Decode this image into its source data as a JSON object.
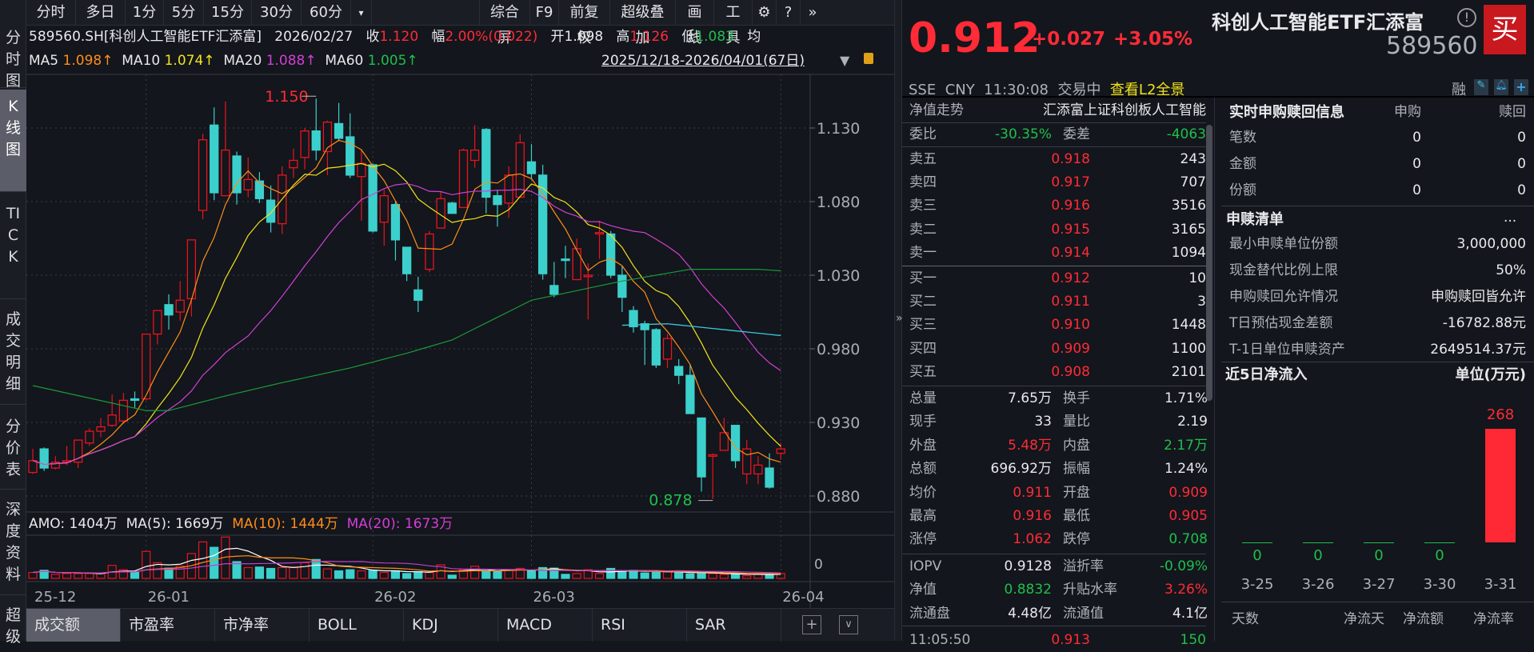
{
  "toolbar": {
    "periods": [
      "分时",
      "多日",
      "1分",
      "5分",
      "15分",
      "30分",
      "60分"
    ],
    "more": "▾",
    "right": [
      "综合屏",
      "F9",
      "前复权",
      "超级叠加",
      "画线",
      "工具"
    ]
  },
  "sidebar": [
    "分时图",
    "K线图",
    "TICK",
    "成交明细",
    "分价表",
    "深度资料",
    "超级"
  ],
  "info": {
    "code_name": "589560.SH[科创人工智能ETF汇添富]",
    "date": "2026/02/27",
    "close_label": "收",
    "close": "1.120",
    "range_label": "幅",
    "range": "2.00%(0.022)",
    "open_label": "开",
    "open": "1.098",
    "high_label": "高",
    "high": "1.126",
    "low_label": "低",
    "low": "1.083",
    "avg_label": "均"
  },
  "ma": {
    "ma5_label": "MA5",
    "ma5": "1.098↑",
    "ma10_label": "MA10",
    "ma10": "1.074↑",
    "ma20_label": "MA20",
    "ma20": "1.088↑",
    "ma60_label": "MA60",
    "ma60": "1.005↑",
    "date_range": "2025/12/18-2026/04/01(67日)"
  },
  "volume": {
    "amo": "AMO: 1404万",
    "ma5": "MA(5): 1669万",
    "ma10": "MA(10): 1444万",
    "ma20": "MA(20): 1673万",
    "zero": "0"
  },
  "tabs": [
    "成交额",
    "市盈率",
    "市净率",
    "BOLL",
    "KDJ",
    "MACD",
    "RSI",
    "SAR"
  ],
  "chart_data": {
    "type": "candlestick",
    "price_ticks": [
      "1.130",
      "1.080",
      "1.030",
      "0.980",
      "0.930",
      "0.880"
    ],
    "ylim": [
      0.88,
      1.13
    ],
    "date_labels": [
      {
        "i": 0,
        "t": "25-12"
      },
      {
        "i": 10,
        "t": "26-01"
      },
      {
        "i": 30,
        "t": "26-02"
      },
      {
        "i": 44,
        "t": "26-03"
      },
      {
        "i": 66,
        "t": "26-04"
      }
    ],
    "annotations": {
      "high": {
        "i": 25,
        "text": "1.150"
      },
      "low": {
        "i": 60,
        "text": "0.878"
      }
    },
    "ohlc": [
      [
        0.896,
        0.912,
        0.895,
        0.904
      ],
      [
        0.912,
        0.913,
        0.897,
        0.899
      ],
      [
        0.899,
        0.907,
        0.898,
        0.903
      ],
      [
        0.903,
        0.914,
        0.901,
        0.904
      ],
      [
        0.903,
        0.918,
        0.899,
        0.918
      ],
      [
        0.916,
        0.926,
        0.914,
        0.924
      ],
      [
        0.924,
        0.933,
        0.92,
        0.927
      ],
      [
        0.928,
        0.949,
        0.927,
        0.935
      ],
      [
        0.931,
        0.95,
        0.929,
        0.945
      ],
      [
        0.946,
        0.951,
        0.94,
        0.945
      ],
      [
        0.946,
        0.99,
        0.945,
        0.99
      ],
      [
        0.99,
        1.006,
        0.983,
        1.006
      ],
      [
        1.01,
        1.017,
        0.993,
        1.003
      ],
      [
        1.005,
        1.026,
        0.999,
        1.013
      ],
      [
        1.014,
        1.054,
        1.002,
        1.054
      ],
      [
        1.074,
        1.126,
        1.068,
        1.122
      ],
      [
        1.132,
        1.144,
        1.081,
        1.086
      ],
      [
        1.084,
        1.148,
        1.084,
        1.115
      ],
      [
        1.111,
        1.114,
        1.078,
        1.086
      ],
      [
        1.088,
        1.11,
        1.083,
        1.095
      ],
      [
        1.094,
        1.1,
        1.079,
        1.082
      ],
      [
        1.081,
        1.091,
        1.059,
        1.066
      ],
      [
        1.065,
        1.104,
        1.058,
        1.098
      ],
      [
        1.103,
        1.116,
        1.096,
        1.108
      ],
      [
        1.11,
        1.13,
        1.102,
        1.128
      ],
      [
        1.128,
        1.15,
        1.108,
        1.115
      ],
      [
        1.114,
        1.135,
        1.098,
        1.134
      ],
      [
        1.133,
        1.147,
        1.121,
        1.123
      ],
      [
        1.124,
        1.14,
        1.096,
        1.098
      ],
      [
        1.097,
        1.115,
        1.067,
        1.106
      ],
      [
        1.105,
        1.106,
        1.059,
        1.06
      ],
      [
        1.066,
        1.088,
        1.05,
        1.084
      ],
      [
        1.078,
        1.08,
        1.04,
        1.054
      ],
      [
        1.049,
        1.049,
        1.026,
        1.031
      ],
      [
        1.02,
        1.029,
        1.005,
        1.013
      ],
      [
        1.034,
        1.06,
        1.032,
        1.058
      ],
      [
        1.062,
        1.087,
        1.062,
        1.082
      ],
      [
        1.079,
        1.08,
        1.072,
        1.072
      ],
      [
        1.076,
        1.116,
        1.076,
        1.115
      ],
      [
        1.108,
        1.132,
        1.103,
        1.115
      ],
      [
        1.129,
        1.13,
        1.072,
        1.083
      ],
      [
        1.084,
        1.088,
        1.063,
        1.078
      ],
      [
        1.079,
        1.104,
        1.069,
        1.098
      ],
      [
        1.083,
        1.126,
        1.083,
        1.12
      ],
      [
        1.107,
        1.119,
        1.095,
        1.099
      ],
      [
        1.098,
        1.105,
        1.027,
        1.031
      ],
      [
        1.023,
        1.039,
        1.015,
        1.017
      ],
      [
        1.041,
        1.05,
        1.028,
        1.04
      ],
      [
        1.027,
        1.055,
        1.027,
        1.048
      ],
      [
        1.029,
        1.038,
        1.0,
        1.03
      ],
      [
        1.058,
        1.067,
        1.041,
        1.059
      ],
      [
        1.058,
        1.06,
        1.028,
        1.03
      ],
      [
        1.03,
        1.036,
        1.005,
        1.015
      ],
      [
        1.006,
        1.009,
        0.991,
        0.995
      ],
      [
        0.997,
        0.999,
        0.969,
        0.993
      ],
      [
        0.993,
        0.994,
        0.967,
        0.969
      ],
      [
        0.973,
        0.99,
        0.967,
        0.987
      ],
      [
        0.968,
        0.973,
        0.956,
        0.962
      ],
      [
        0.962,
        0.969,
        0.936,
        0.936
      ],
      [
        0.933,
        0.933,
        0.883,
        0.893
      ],
      [
        0.907,
        0.909,
        0.878,
        0.908
      ],
      [
        0.911,
        0.933,
        0.911,
        0.923
      ],
      [
        0.928,
        0.928,
        0.899,
        0.904
      ],
      [
        0.895,
        0.918,
        0.888,
        0.912
      ],
      [
        0.895,
        0.907,
        0.888,
        0.901
      ],
      [
        0.899,
        0.909,
        0.885,
        0.886
      ],
      [
        0.909,
        0.916,
        0.905,
        0.912
      ]
    ],
    "ma60_points": [
      [
        0,
        0.955
      ],
      [
        10,
        0.938
      ],
      [
        12,
        0.938
      ],
      [
        17,
        0.948
      ],
      [
        22,
        0.957
      ],
      [
        28,
        0.967
      ],
      [
        33,
        0.977
      ],
      [
        37,
        0.986
      ],
      [
        44,
        1.013
      ],
      [
        52,
        1.026
      ],
      [
        58,
        1.034
      ],
      [
        64,
        1.034
      ],
      [
        66,
        1.033
      ]
    ],
    "cost_line": [
      [
        52,
        0.996
      ],
      [
        56,
        0.997
      ],
      [
        66,
        0.989
      ]
    ],
    "volume_wan": [
      1716,
      2340,
      1170,
      1404,
      1404,
      1404,
      1404,
      3744,
      2496,
      1716,
      7800,
      4524,
      2964,
      3510,
      7176,
      10530,
      8970,
      11934,
      4836,
      3120,
      3276,
      2886,
      3120,
      3276,
      4524,
      5460,
      2730,
      2184,
      2496,
      2184,
      2340,
      1716,
      2184,
      1404,
      1950,
      1716,
      3900,
      936,
      2496,
      3510,
      1950,
      1950,
      2496,
      2886,
      2340,
      3120,
      2964,
      1170,
      1404,
      2496,
      1404,
      2886,
      1950,
      2340,
      1560,
      1716,
      1950,
      1950,
      1326,
      1404,
      1404,
      1170,
      1326,
      780,
      1170,
      1170,
      1404
    ],
    "colors": {
      "up": "#e8141f",
      "down": "#3cd0cd",
      "ma5": "#ff8c1a",
      "ma10": "#f2e31b",
      "ma20": "#d23fd6",
      "ma60": "#1a9a3a",
      "cost": "#3cc8e0",
      "vma5": "#ffffff",
      "vma10": "#ff8c1a",
      "vma20": "#c040d0"
    }
  },
  "quote": {
    "price": "0.912",
    "change": "+0.027",
    "pct": "+3.05%",
    "name": "科创人工智能ETF汇添富",
    "code": "589560",
    "buy": "买",
    "market": "SSE",
    "currency": "CNY",
    "time": "11:30:08",
    "status": "交易中",
    "l2_link": "查看L2全景",
    "rong": "融"
  },
  "book": {
    "nav_label": "净值走势",
    "index_name": "汇添富上证科创板人工智能",
    "wb_label": "委比",
    "wb": "-30.35%",
    "wc_label": "委差",
    "wc": "-4063",
    "asks": [
      {
        "l": "卖五",
        "p": "0.918",
        "q": "243"
      },
      {
        "l": "卖四",
        "p": "0.917",
        "q": "707"
      },
      {
        "l": "卖三",
        "p": "0.916",
        "q": "3516"
      },
      {
        "l": "卖二",
        "p": "0.915",
        "q": "3165"
      },
      {
        "l": "卖一",
        "p": "0.914",
        "q": "1094"
      }
    ],
    "bids": [
      {
        "l": "买一",
        "p": "0.912",
        "q": "10"
      },
      {
        "l": "买二",
        "p": "0.911",
        "q": "3"
      },
      {
        "l": "买三",
        "p": "0.910",
        "q": "1448"
      },
      {
        "l": "买四",
        "p": "0.909",
        "q": "1100"
      },
      {
        "l": "买五",
        "p": "0.908",
        "q": "2101"
      }
    ]
  },
  "stats": [
    {
      "l1": "总量",
      "v1": "7.65万",
      "c1": "white",
      "l2": "换手",
      "v2": "1.71%",
      "c2": "white"
    },
    {
      "l1": "现手",
      "v1": "33",
      "c1": "white",
      "l2": "量比",
      "v2": "2.19",
      "c2": "white"
    },
    {
      "l1": "外盘",
      "v1": "5.48万",
      "c1": "red",
      "l2": "内盘",
      "v2": "2.17万",
      "c2": "green"
    },
    {
      "l1": "总额",
      "v1": "696.92万",
      "c1": "white",
      "l2": "振幅",
      "v2": "1.24%",
      "c2": "white"
    },
    {
      "l1": "均价",
      "v1": "0.911",
      "c1": "red",
      "l2": "开盘",
      "v2": "0.909",
      "c2": "red"
    },
    {
      "l1": "最高",
      "v1": "0.916",
      "c1": "red",
      "l2": "最低",
      "v2": "0.905",
      "c2": "red"
    },
    {
      "l1": "涨停",
      "v1": "1.062",
      "c1": "red",
      "l2": "跌停",
      "v2": "0.708",
      "c2": "green"
    }
  ],
  "etf": [
    {
      "l1": "IOPV",
      "v1": "0.9128",
      "c1": "white",
      "l2": "溢折率",
      "v2": "-0.09%",
      "c2": "green"
    },
    {
      "l1": "净值",
      "v1": "0.8832",
      "c1": "green",
      "l2": "升贴水率",
      "v2": "3.26%",
      "c2": "red"
    },
    {
      "l1": "流通盘",
      "v1": "4.48亿",
      "c1": "white",
      "l2": "流通值",
      "v2": "4.1亿",
      "c2": "white"
    }
  ],
  "tick": {
    "time": "11:05:50",
    "price": "0.913",
    "vol": "150"
  },
  "redeem": {
    "title": "实时申购赎回信息",
    "col1": "申购",
    "col2": "赎回",
    "rows": [
      {
        "l": "笔数",
        "a": "0",
        "b": "0"
      },
      {
        "l": "金额",
        "a": "0",
        "b": "0"
      },
      {
        "l": "份额",
        "a": "0",
        "b": "0"
      }
    ],
    "list_title": "申赎清单",
    "more": "...",
    "list": [
      {
        "l": "最小申赎单位份额",
        "v": "3,000,000"
      },
      {
        "l": "现金替代比例上限",
        "v": "50%"
      },
      {
        "l": "申购赎回允许情况",
        "v": "申购赎回皆允许"
      },
      {
        "l": "T日预估现金差额",
        "v": "-16782.88元"
      },
      {
        "l": "T-1日单位申赎资产",
        "v": "2649514.37元"
      }
    ]
  },
  "flow": {
    "title": "近5日净流入",
    "unit": "单位(万元)",
    "dates": [
      "3-25",
      "3-26",
      "3-27",
      "3-30",
      "3-31"
    ],
    "values": [
      0,
      0,
      0,
      0,
      268
    ],
    "labels": [
      "0",
      "0",
      "0",
      "0",
      "268"
    ],
    "footer": [
      "天数",
      "净流天",
      "净流额",
      "净流率"
    ]
  }
}
